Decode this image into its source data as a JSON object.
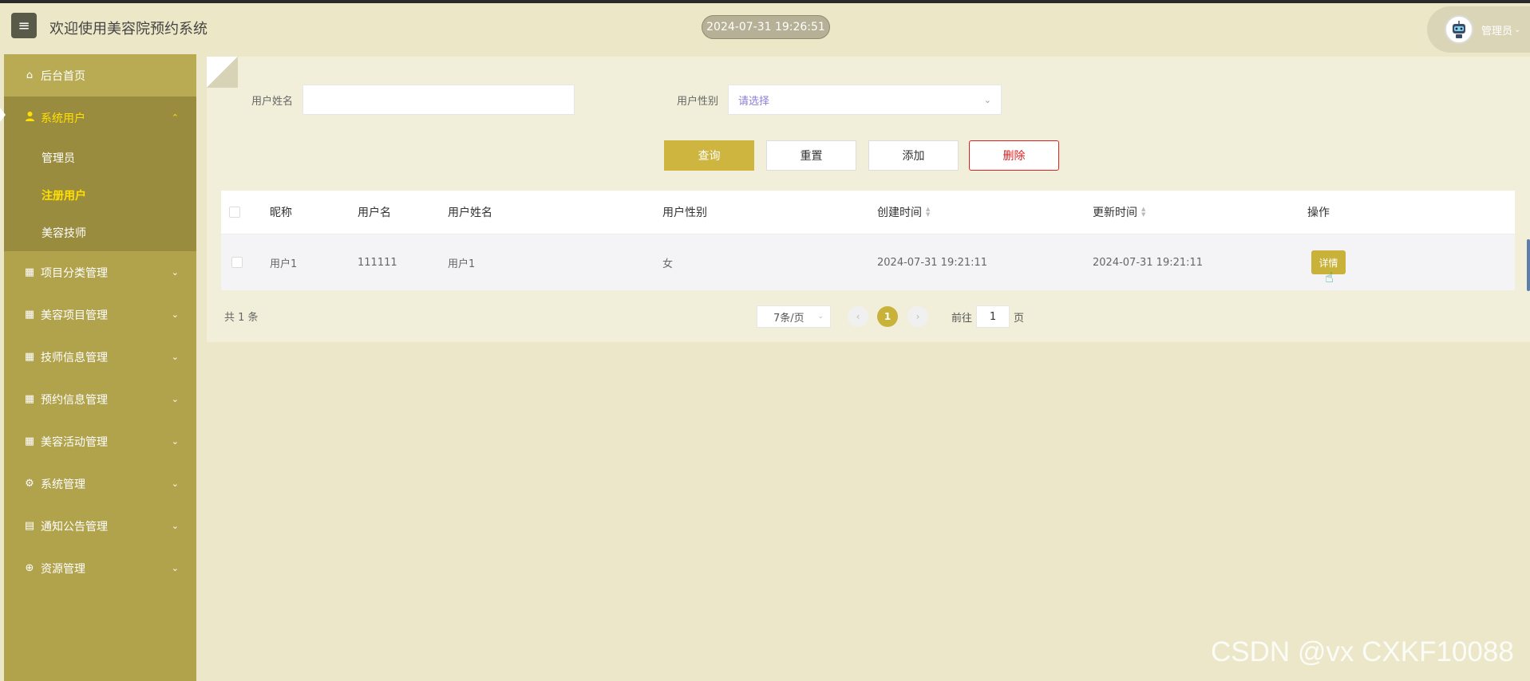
{
  "header": {
    "menu_icon": "hamburger-icon",
    "title": "欢迎使用美容院预约系统",
    "datetime": "2024-07-31 19:26:51",
    "user_label": "管理员"
  },
  "sidebar": {
    "home": {
      "label": "后台首页",
      "icon": "home-icon"
    },
    "system_users": {
      "label": "系统用户",
      "icon": "user-icon",
      "children": [
        "管理员",
        "注册用户",
        "美容技师"
      ],
      "current": "注册用户"
    },
    "groups": [
      {
        "label": "项目分类管理",
        "icon": "grid-icon"
      },
      {
        "label": "美容项目管理",
        "icon": "grid-icon"
      },
      {
        "label": "技师信息管理",
        "icon": "grid-icon"
      },
      {
        "label": "预约信息管理",
        "icon": "grid-icon"
      },
      {
        "label": "美容活动管理",
        "icon": "grid-icon"
      },
      {
        "label": "系统管理",
        "icon": "gear-icon"
      },
      {
        "label": "通知公告管理",
        "icon": "document-icon"
      },
      {
        "label": "资源管理",
        "icon": "plus-circle-icon"
      }
    ]
  },
  "filters": {
    "name_label": "用户姓名",
    "name_value": "",
    "gender_label": "用户性别",
    "gender_placeholder": "请选择"
  },
  "actions": {
    "query": "查询",
    "reset": "重置",
    "add": "添加",
    "delete": "删除"
  },
  "table": {
    "columns": [
      "昵称",
      "用户名",
      "用户姓名",
      "用户性别",
      "创建时间",
      "更新时间",
      "操作"
    ],
    "rows": [
      {
        "nickname": "用户1",
        "username": "111111",
        "real_name": "用户1",
        "gender": "女",
        "created": "2024-07-31 19:21:11",
        "updated": "2024-07-31 19:21:11",
        "action": "详情"
      }
    ]
  },
  "pagination": {
    "total": "共 1 条",
    "page_size": "7条/页",
    "current_page": "1",
    "goto_prefix": "前往",
    "goto_value": "1",
    "goto_suffix": "页"
  },
  "watermark": "CSDN @vx  CXKF10088",
  "colors": {
    "sidebar": "#b1a24c",
    "accent": "#cdb53f",
    "active_text": "#ffe000",
    "danger": "#e02020",
    "background": "#ebe7c8"
  }
}
